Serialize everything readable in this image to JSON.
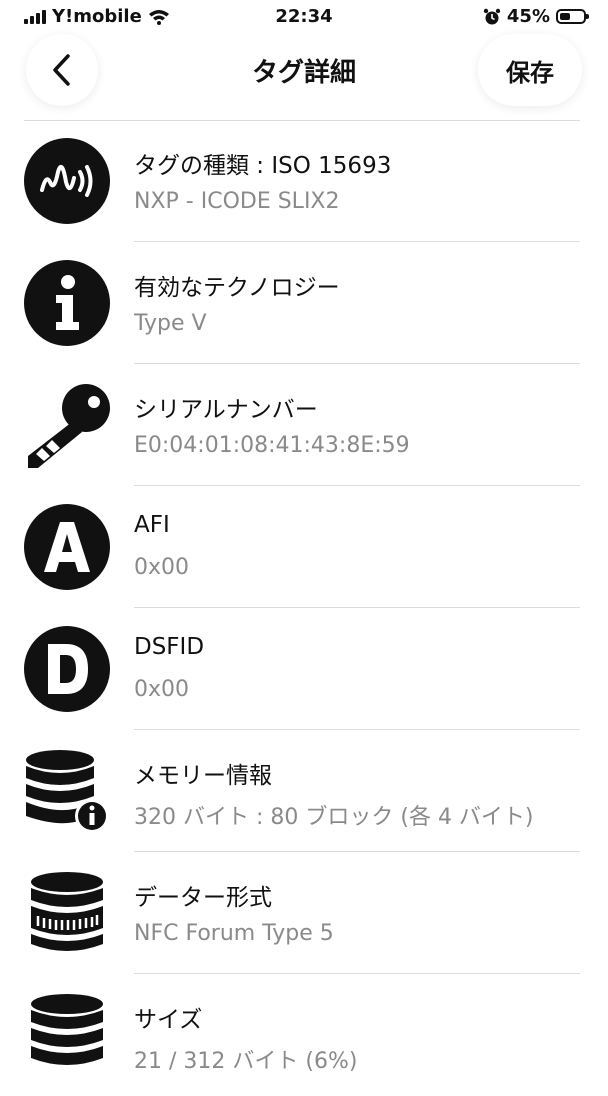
{
  "status_bar": {
    "carrier": "Y!mobile",
    "time": "22:34",
    "battery": "45%",
    "battery_level": 0.45,
    "icons": [
      "signal-icon",
      "wifi-icon",
      "alarm-icon",
      "battery-icon"
    ]
  },
  "nav": {
    "back_icon": "chevron-left-icon",
    "title": "タグ詳細",
    "save_label": "保存"
  },
  "rows": [
    {
      "icon": "nfc-tag-icon",
      "title": "タグの種類 : ISO 15693",
      "subtitle": "NXP - ICODE SLIX2"
    },
    {
      "icon": "info-icon",
      "title": "有効なテクノロジー",
      "subtitle": "Type V"
    },
    {
      "icon": "key-icon",
      "title": "シリアルナンバー",
      "subtitle": "E0:04:01:08:41:43:8E:59"
    },
    {
      "icon": "letter-a-icon",
      "title": "AFI",
      "subtitle": "0x00"
    },
    {
      "icon": "letter-d-icon",
      "title": "DSFID",
      "subtitle": "0x00"
    },
    {
      "icon": "database-info-icon",
      "title": "メモリー情報",
      "subtitle": "320 バイト : 80 ブロック (各 4 バイト)"
    },
    {
      "icon": "data-format-icon",
      "title": "データー形式",
      "subtitle": "NFC Forum Type 5"
    },
    {
      "icon": "database-icon",
      "title": "サイズ",
      "subtitle": "21 / 312 バイト (6%)"
    }
  ],
  "colors": {
    "text": "#111111",
    "subtext": "#8a8a8a",
    "divider": "#dcdcdc",
    "background": "#ffffff"
  }
}
